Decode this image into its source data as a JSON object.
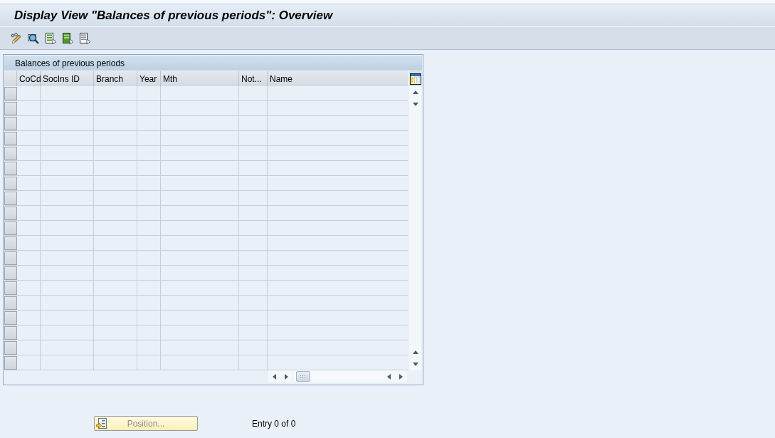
{
  "window": {
    "title": "Display View \"Balances of previous periods\": Overview"
  },
  "table": {
    "title": "Balances of previous periods",
    "columns": [
      "CoCd",
      "SocIns ID",
      "Branch",
      "Year",
      "Mth",
      "Not...",
      "Name"
    ]
  },
  "footer": {
    "position_button": {
      "label": "Position...",
      "disabled": true
    },
    "entry_count": "Entry 0 of 0"
  }
}
